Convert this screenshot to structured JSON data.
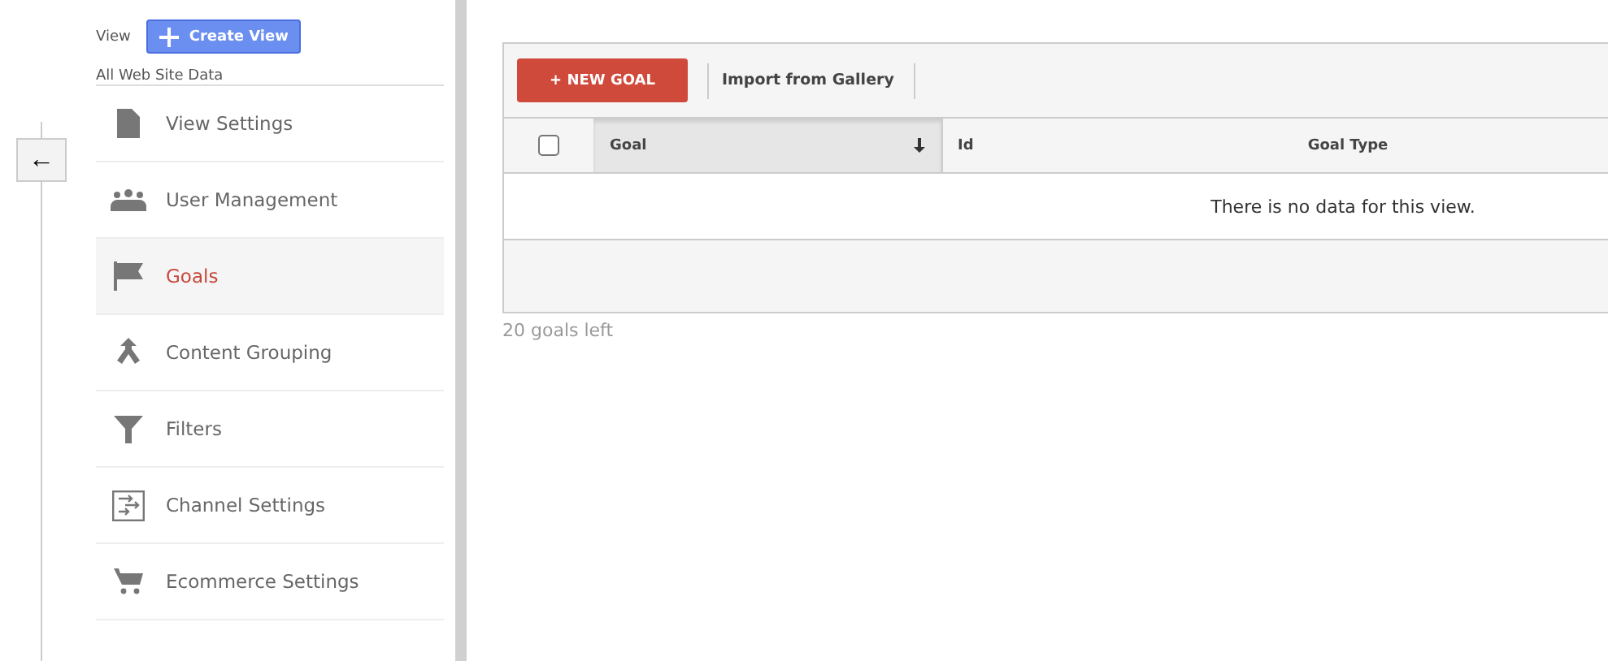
{
  "view_header": {
    "label": "View",
    "create_button": "Create View",
    "view_name": "All Web Site Data"
  },
  "back_button": {
    "icon": "←"
  },
  "nav_items": [
    {
      "label": "View Settings",
      "selected": false
    },
    {
      "label": "User Management",
      "selected": false
    },
    {
      "label": "Goals",
      "selected": true
    },
    {
      "label": "Content Grouping",
      "selected": false
    },
    {
      "label": "Filters",
      "selected": false
    },
    {
      "label": "Channel Settings",
      "selected": false
    },
    {
      "label": "Ecommerce Settings",
      "selected": false
    }
  ],
  "toolbar": {
    "new_button": "+ NEW GOAL",
    "import_link": "Import from Gallery"
  },
  "table": {
    "select_all_checked": false,
    "columns": [
      {
        "label": "Goal",
        "sorted": true
      },
      {
        "label": "Id",
        "sorted": false
      },
      {
        "label": "Goal Type",
        "sorted": false
      }
    ],
    "empty_message": "There is no data for this view."
  },
  "goals_left": "20 goals left"
}
